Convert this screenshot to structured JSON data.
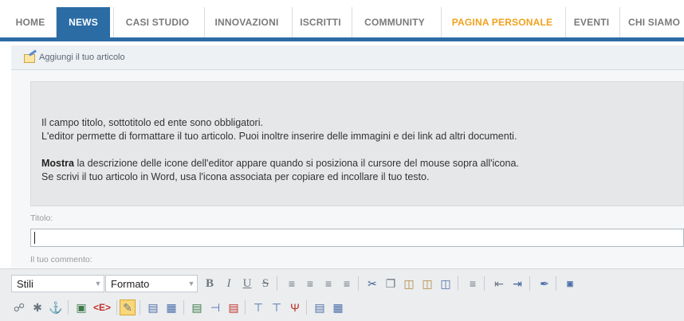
{
  "nav": {
    "items": [
      {
        "label": "HOME"
      },
      {
        "label": "NEWS"
      },
      {
        "label": "CASI STUDIO"
      },
      {
        "label": "INNOVAZIONI"
      },
      {
        "label": "ISCRITTI"
      },
      {
        "label": "COMMUNITY"
      },
      {
        "label": "PAGINA PERSONALE"
      },
      {
        "label": "EVENTI"
      },
      {
        "label": "CHI SIAMO"
      }
    ],
    "active_color": "#2b6ca5",
    "highlight_color": "#f0a21e"
  },
  "strip": {
    "add_article_label": "Aggiungi il tuo articolo"
  },
  "info": {
    "line1": "Il campo titolo, sottotitolo ed ente sono obbligatori.",
    "line2": "L'editor permette di formattare il tuo articolo. Puoi inoltre inserire delle immagini e dei link ad altri documenti.",
    "line3_bold": "Mostra",
    "line3_rest": " la descrizione delle icone dell'editor appare quando si posiziona il cursore del mouse sopra all'icona.",
    "line4": "Se scrivi il tuo articolo in Word, usa l'icona associata per copiare ed incollare il tuo testo."
  },
  "form": {
    "title_label": "Titolo:",
    "title_value": "",
    "comment_label": "Il tuo commento:"
  },
  "editor": {
    "styles_combo": "Stili",
    "format_combo": "Formato",
    "bold": "B",
    "italic": "I",
    "underline": "U",
    "strike": "S",
    "source": "<E>"
  }
}
